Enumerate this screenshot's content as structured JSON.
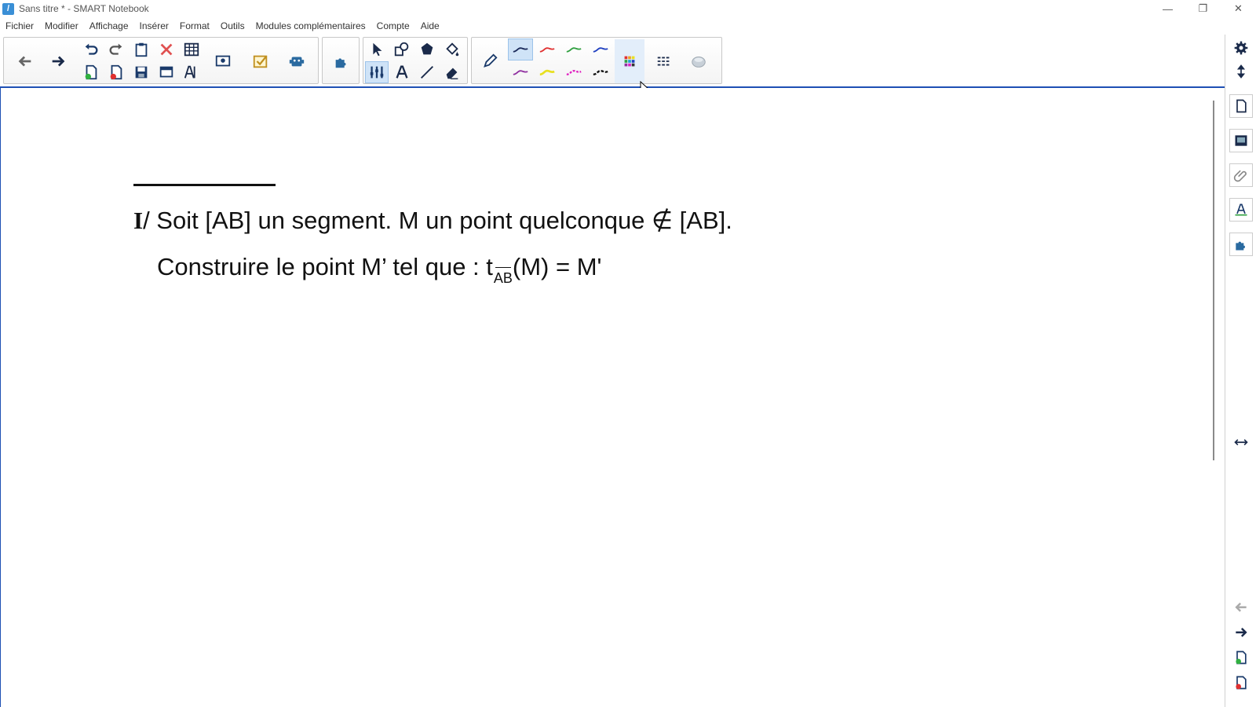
{
  "window": {
    "title": "Sans titre * - SMART Notebook",
    "minimize": "—",
    "restore": "❐",
    "close": "✕"
  },
  "menu": [
    "Fichier",
    "Modifier",
    "Affichage",
    "Insérer",
    "Format",
    "Outils",
    "Modules complémentaires",
    "Compte",
    "Aide"
  ],
  "toolbar": {
    "icons": [
      "back-arrow-icon",
      "forward-arrow-icon",
      "undo-icon",
      "redo-icon",
      "paste-icon",
      "delete-icon",
      "table-icon",
      "new-page-icon",
      "delete-page-icon",
      "save-icon",
      "screen-shade-icon",
      "text-format-icon",
      "document-camera-icon",
      "response-check-icon",
      "activity-builder-icon",
      "addons-puzzle-icon",
      "select-pointer-icon",
      "shapes-icon",
      "polygon-icon",
      "fill-icon",
      "measure-tools-icon",
      "text-tool-icon",
      "line-tool-icon",
      "eraser-icon",
      "pen-icon",
      "pen-style-black",
      "pen-style-red",
      "pen-style-green",
      "pen-style-blue",
      "pen-style-purple",
      "pen-style-yellow",
      "pen-style-magenta",
      "pen-style-dashed-black",
      "color-palette-icon",
      "line-properties-icon",
      "3d-object-icon"
    ],
    "colors": {
      "accent": "#1e50b4",
      "pen_black": "#1a2a5a",
      "pen_red": "#e03030",
      "pen_green": "#30a040",
      "pen_blue": "#2040c0",
      "pen_purple": "#9030a0",
      "pen_yellow": "#e8e020",
      "pen_magenta": "#e020c0"
    }
  },
  "document": {
    "line1_roman": "I",
    "line1": "/ Soit [AB] un segment. M un point quelconque ∉ [AB].",
    "line2": "Construire le point M’ tel que :  t",
    "line2_subscript": "AB",
    "line2_tail": "(M) = M'"
  },
  "sidebar": {
    "icons": [
      "settings-gear-icon",
      "move-toolbar-icon",
      "page-sorter-icon",
      "gallery-icon",
      "attachments-icon",
      "properties-icon",
      "addons-icon",
      "resize-sidebar-icon",
      "previous-page-icon",
      "next-page-icon",
      "add-page-icon",
      "delete-page-icon"
    ]
  }
}
